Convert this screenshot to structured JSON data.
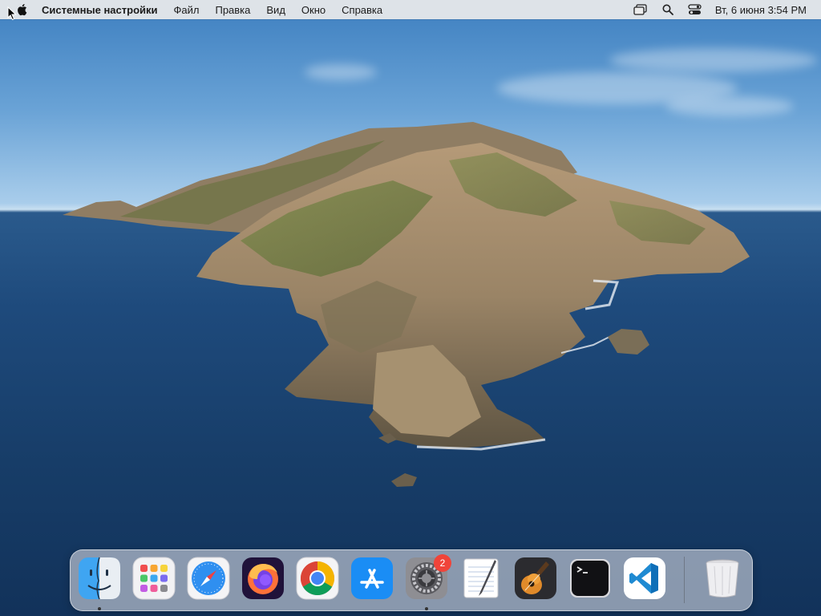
{
  "menubar": {
    "apple_icon": "apple-logo-icon",
    "app_name": "Системные настройки",
    "items": [
      "Файл",
      "Правка",
      "Вид",
      "Окно",
      "Справка"
    ],
    "status_icons": [
      "screen-mirroring-icon",
      "search-icon",
      "control-center-icon"
    ],
    "clock": "Вт, 6 июня  3:54 PM"
  },
  "desktop": {
    "wallpaper": "island-ocean-wallpaper"
  },
  "dock": {
    "apps": [
      {
        "name": "finder",
        "icon": "finder-icon",
        "running": true
      },
      {
        "name": "launchpad",
        "icon": "launchpad-icon",
        "running": false
      },
      {
        "name": "safari",
        "icon": "safari-icon",
        "running": false
      },
      {
        "name": "firefox",
        "icon": "firefox-icon",
        "running": false
      },
      {
        "name": "chrome",
        "icon": "chrome-icon",
        "running": false
      },
      {
        "name": "app-store",
        "icon": "app-store-icon",
        "running": false
      },
      {
        "name": "system-preferences",
        "icon": "system-preferences-icon",
        "running": true,
        "badge": "2"
      },
      {
        "name": "textedit",
        "icon": "textedit-icon",
        "running": false
      },
      {
        "name": "garageband",
        "icon": "garageband-icon",
        "running": false
      },
      {
        "name": "terminal",
        "icon": "terminal-icon",
        "running": false
      },
      {
        "name": "vscode",
        "icon": "vscode-icon",
        "running": false
      },
      {
        "name": "trash",
        "icon": "trash-icon",
        "running": false
      }
    ]
  }
}
